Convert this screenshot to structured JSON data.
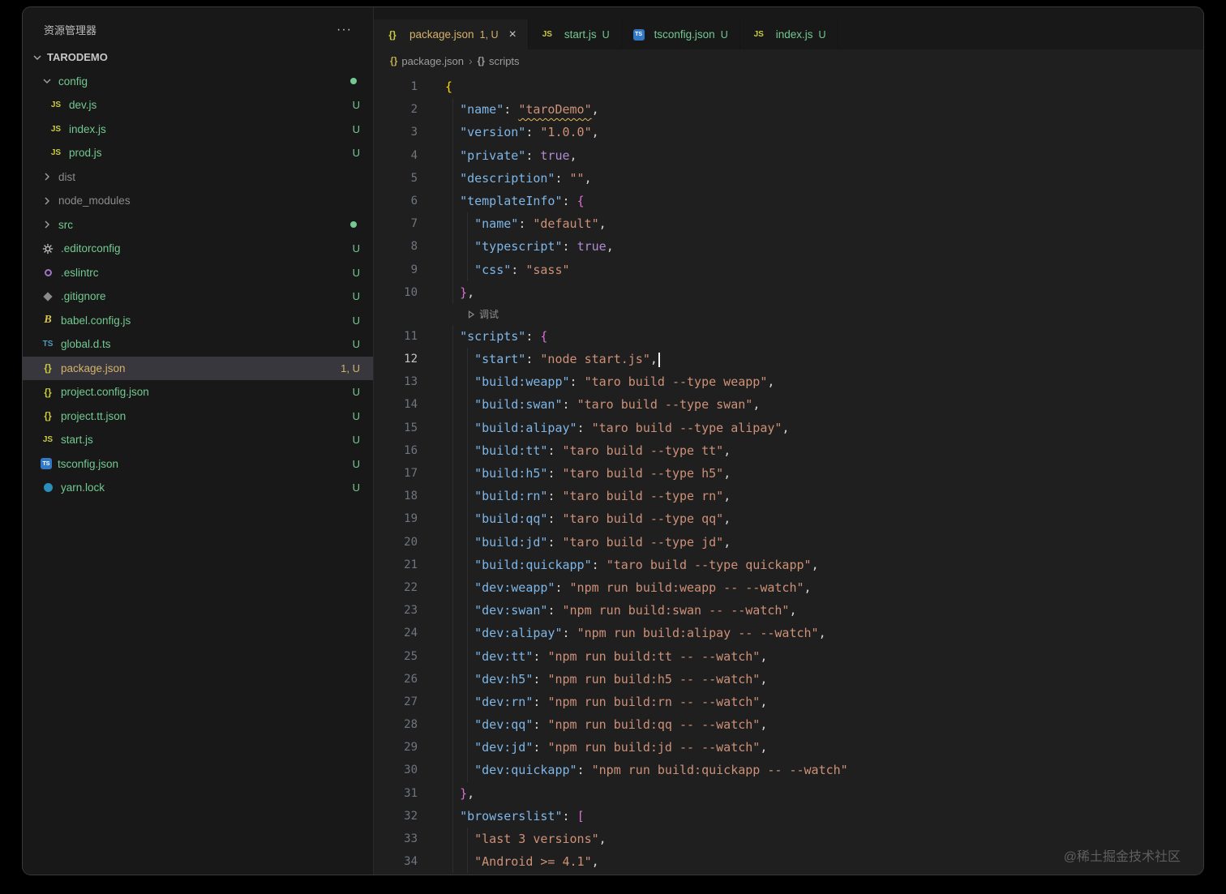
{
  "colors": {
    "untracked": "#73c991",
    "ignored": "#8c8c8c",
    "warning": "#d5b26b",
    "key": "#7eb6e8",
    "string": "#ce9178",
    "keyword": "#b18bd3",
    "b1": "#ffd700",
    "b2": "#da70d6",
    "squiggle": "#e5b95c"
  },
  "sidebar": {
    "header": "资源管理器",
    "more_icon": "···",
    "project": "TARODEMO",
    "items": [
      {
        "label": "config",
        "type": "folder",
        "expanded": true,
        "indent": 1,
        "badge": "dot",
        "state": "untracked"
      },
      {
        "label": "dev.js",
        "icon": "js",
        "indent": 2,
        "badge": "U",
        "state": "untracked"
      },
      {
        "label": "index.js",
        "icon": "js",
        "indent": 2,
        "badge": "U",
        "state": "untracked"
      },
      {
        "label": "prod.js",
        "icon": "js",
        "indent": 2,
        "badge": "U",
        "state": "untracked"
      },
      {
        "label": "dist",
        "type": "folder",
        "expanded": false,
        "indent": 1,
        "state": "ignored"
      },
      {
        "label": "node_modules",
        "type": "folder",
        "expanded": false,
        "indent": 1,
        "state": "ignored"
      },
      {
        "label": "src",
        "type": "folder",
        "expanded": false,
        "indent": 1,
        "badge": "dot",
        "state": "untracked"
      },
      {
        "label": ".editorconfig",
        "icon": "gear",
        "indent": 1,
        "badge": "U",
        "state": "untracked"
      },
      {
        "label": ".eslintrc",
        "icon": "eslint",
        "indent": 1,
        "badge": "U",
        "state": "untracked"
      },
      {
        "label": ".gitignore",
        "icon": "diamond",
        "indent": 1,
        "badge": "U",
        "state": "untracked"
      },
      {
        "label": "babel.config.js",
        "icon": "babel",
        "indent": 1,
        "badge": "U",
        "state": "untracked"
      },
      {
        "label": "global.d.ts",
        "icon": "ts",
        "indent": 1,
        "badge": "U",
        "state": "untracked"
      },
      {
        "label": "package.json",
        "icon": "json",
        "indent": 1,
        "badge": "1, U",
        "state": "warning",
        "selected": true
      },
      {
        "label": "project.config.json",
        "icon": "json",
        "indent": 1,
        "badge": "U",
        "state": "untracked"
      },
      {
        "label": "project.tt.json",
        "icon": "json",
        "indent": 1,
        "badge": "U",
        "state": "untracked"
      },
      {
        "label": "start.js",
        "icon": "js",
        "indent": 1,
        "badge": "U",
        "state": "untracked"
      },
      {
        "label": "tsconfig.json",
        "icon": "tsconfig",
        "indent": 1,
        "badge": "U",
        "state": "untracked"
      },
      {
        "label": "yarn.lock",
        "icon": "yarn",
        "indent": 1,
        "badge": "U",
        "state": "untracked"
      }
    ]
  },
  "tabs": {
    "close_icon": "×",
    "items": [
      {
        "label": "package.json",
        "icon": "json",
        "badge": "1, U",
        "state": "warning",
        "active": true,
        "close": true
      },
      {
        "label": "start.js",
        "icon": "js",
        "badge": "U",
        "state": "untracked"
      },
      {
        "label": "tsconfig.json",
        "icon": "tsconfig",
        "badge": "U",
        "state": "untracked"
      },
      {
        "label": "index.js",
        "icon": "js",
        "badge": "U",
        "state": "untracked"
      }
    ]
  },
  "breadcrumb": {
    "separator": "›",
    "items": [
      {
        "icon": "braces",
        "label": "package.json"
      },
      {
        "icon": "braces",
        "label": "scripts"
      }
    ]
  },
  "editor": {
    "active_line": 12,
    "lines": [
      {
        "n": 1,
        "t": [
          [
            "{",
            "b1"
          ]
        ]
      },
      {
        "n": 2,
        "t": [
          [
            "  "
          ],
          [
            "\"name\"",
            "k"
          ],
          [
            ": "
          ],
          [
            "\"taroDemo\"",
            "s sq"
          ],
          [
            ","
          ]
        ]
      },
      {
        "n": 3,
        "t": [
          [
            "  "
          ],
          [
            "\"version\"",
            "k"
          ],
          [
            ": "
          ],
          [
            "\"1.0.0\"",
            "s"
          ],
          [
            ","
          ]
        ]
      },
      {
        "n": 4,
        "t": [
          [
            "  "
          ],
          [
            "\"private\"",
            "k"
          ],
          [
            ": "
          ],
          [
            "true",
            "w"
          ],
          [
            ","
          ]
        ]
      },
      {
        "n": 5,
        "t": [
          [
            "  "
          ],
          [
            "\"description\"",
            "k"
          ],
          [
            ": "
          ],
          [
            "\"\"",
            "s"
          ],
          [
            ","
          ]
        ]
      },
      {
        "n": 6,
        "t": [
          [
            "  "
          ],
          [
            "\"templateInfo\"",
            "k"
          ],
          [
            ": "
          ],
          [
            "{",
            "b2"
          ]
        ]
      },
      {
        "n": 7,
        "t": [
          [
            "    "
          ],
          [
            "\"name\"",
            "k"
          ],
          [
            ": "
          ],
          [
            "\"default\"",
            "s"
          ],
          [
            ","
          ]
        ]
      },
      {
        "n": 8,
        "t": [
          [
            "    "
          ],
          [
            "\"typescript\"",
            "k"
          ],
          [
            ": "
          ],
          [
            "true",
            "w"
          ],
          [
            ","
          ]
        ]
      },
      {
        "n": 9,
        "t": [
          [
            "    "
          ],
          [
            "\"css\"",
            "k"
          ],
          [
            ": "
          ],
          [
            "\"sass\"",
            "s"
          ]
        ]
      },
      {
        "n": 10,
        "t": [
          [
            "  "
          ],
          [
            "}",
            "b2"
          ],
          [
            ","
          ]
        ]
      },
      {
        "codelens": true,
        "label": "调试"
      },
      {
        "n": 11,
        "t": [
          [
            "  "
          ],
          [
            "\"scripts\"",
            "k"
          ],
          [
            ": "
          ],
          [
            "{",
            "b2"
          ]
        ]
      },
      {
        "n": 12,
        "cursor": true,
        "t": [
          [
            "    "
          ],
          [
            "\"start\"",
            "k"
          ],
          [
            ": "
          ],
          [
            "\"node start.js\"",
            "s"
          ],
          [
            ","
          ]
        ]
      },
      {
        "n": 13,
        "t": [
          [
            "    "
          ],
          [
            "\"build:weapp\"",
            "k"
          ],
          [
            ": "
          ],
          [
            "\"taro build --type weapp\"",
            "s"
          ],
          [
            ","
          ]
        ]
      },
      {
        "n": 14,
        "t": [
          [
            "    "
          ],
          [
            "\"build:swan\"",
            "k"
          ],
          [
            ": "
          ],
          [
            "\"taro build --type swan\"",
            "s"
          ],
          [
            ","
          ]
        ]
      },
      {
        "n": 15,
        "t": [
          [
            "    "
          ],
          [
            "\"build:alipay\"",
            "k"
          ],
          [
            ": "
          ],
          [
            "\"taro build --type alipay\"",
            "s"
          ],
          [
            ","
          ]
        ]
      },
      {
        "n": 16,
        "t": [
          [
            "    "
          ],
          [
            "\"build:tt\"",
            "k"
          ],
          [
            ": "
          ],
          [
            "\"taro build --type tt\"",
            "s"
          ],
          [
            ","
          ]
        ]
      },
      {
        "n": 17,
        "t": [
          [
            "    "
          ],
          [
            "\"build:h5\"",
            "k"
          ],
          [
            ": "
          ],
          [
            "\"taro build --type h5\"",
            "s"
          ],
          [
            ","
          ]
        ]
      },
      {
        "n": 18,
        "t": [
          [
            "    "
          ],
          [
            "\"build:rn\"",
            "k"
          ],
          [
            ": "
          ],
          [
            "\"taro build --type rn\"",
            "s"
          ],
          [
            ","
          ]
        ]
      },
      {
        "n": 19,
        "t": [
          [
            "    "
          ],
          [
            "\"build:qq\"",
            "k"
          ],
          [
            ": "
          ],
          [
            "\"taro build --type qq\"",
            "s"
          ],
          [
            ","
          ]
        ]
      },
      {
        "n": 20,
        "t": [
          [
            "    "
          ],
          [
            "\"build:jd\"",
            "k"
          ],
          [
            ": "
          ],
          [
            "\"taro build --type jd\"",
            "s"
          ],
          [
            ","
          ]
        ]
      },
      {
        "n": 21,
        "t": [
          [
            "    "
          ],
          [
            "\"build:quickapp\"",
            "k"
          ],
          [
            ": "
          ],
          [
            "\"taro build --type quickapp\"",
            "s"
          ],
          [
            ","
          ]
        ]
      },
      {
        "n": 22,
        "t": [
          [
            "    "
          ],
          [
            "\"dev:weapp\"",
            "k"
          ],
          [
            ": "
          ],
          [
            "\"npm run build:weapp -- --watch\"",
            "s"
          ],
          [
            ","
          ]
        ]
      },
      {
        "n": 23,
        "t": [
          [
            "    "
          ],
          [
            "\"dev:swan\"",
            "k"
          ],
          [
            ": "
          ],
          [
            "\"npm run build:swan -- --watch\"",
            "s"
          ],
          [
            ","
          ]
        ]
      },
      {
        "n": 24,
        "t": [
          [
            "    "
          ],
          [
            "\"dev:alipay\"",
            "k"
          ],
          [
            ": "
          ],
          [
            "\"npm run build:alipay -- --watch\"",
            "s"
          ],
          [
            ","
          ]
        ]
      },
      {
        "n": 25,
        "t": [
          [
            "    "
          ],
          [
            "\"dev:tt\"",
            "k"
          ],
          [
            ": "
          ],
          [
            "\"npm run build:tt -- --watch\"",
            "s"
          ],
          [
            ","
          ]
        ]
      },
      {
        "n": 26,
        "t": [
          [
            "    "
          ],
          [
            "\"dev:h5\"",
            "k"
          ],
          [
            ": "
          ],
          [
            "\"npm run build:h5 -- --watch\"",
            "s"
          ],
          [
            ","
          ]
        ]
      },
      {
        "n": 27,
        "t": [
          [
            "    "
          ],
          [
            "\"dev:rn\"",
            "k"
          ],
          [
            ": "
          ],
          [
            "\"npm run build:rn -- --watch\"",
            "s"
          ],
          [
            ","
          ]
        ]
      },
      {
        "n": 28,
        "t": [
          [
            "    "
          ],
          [
            "\"dev:qq\"",
            "k"
          ],
          [
            ": "
          ],
          [
            "\"npm run build:qq -- --watch\"",
            "s"
          ],
          [
            ","
          ]
        ]
      },
      {
        "n": 29,
        "t": [
          [
            "    "
          ],
          [
            "\"dev:jd\"",
            "k"
          ],
          [
            ": "
          ],
          [
            "\"npm run build:jd -- --watch\"",
            "s"
          ],
          [
            ","
          ]
        ]
      },
      {
        "n": 30,
        "t": [
          [
            "    "
          ],
          [
            "\"dev:quickapp\"",
            "k"
          ],
          [
            ": "
          ],
          [
            "\"npm run build:quickapp -- --watch\"",
            "s"
          ]
        ]
      },
      {
        "n": 31,
        "t": [
          [
            "  "
          ],
          [
            "}",
            "b2"
          ],
          [
            ","
          ]
        ]
      },
      {
        "n": 32,
        "t": [
          [
            "  "
          ],
          [
            "\"browserslist\"",
            "k"
          ],
          [
            ": "
          ],
          [
            "[",
            "b2"
          ]
        ]
      },
      {
        "n": 33,
        "t": [
          [
            "    "
          ],
          [
            "\"last 3 versions\"",
            "s"
          ],
          [
            ","
          ]
        ]
      },
      {
        "n": 34,
        "t": [
          [
            "    "
          ],
          [
            "\"Android >= 4.1\"",
            "s"
          ],
          [
            ","
          ]
        ]
      }
    ]
  },
  "watermark": "@稀土掘金技术社区"
}
